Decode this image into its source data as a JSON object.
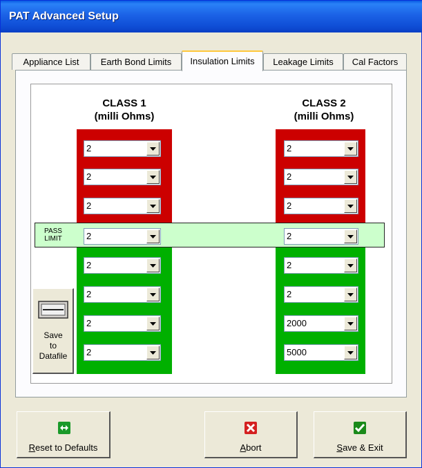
{
  "window": {
    "title": "PAT Advanced Setup"
  },
  "tabs": [
    {
      "label": "Appliance List"
    },
    {
      "label": "Earth Bond Limits"
    },
    {
      "label": "Insulation Limits"
    },
    {
      "label": "Leakage Limits"
    },
    {
      "label": "Cal Factors"
    }
  ],
  "active_tab": "Insulation Limits",
  "class1": {
    "title": "CLASS 1",
    "subtitle": "(milli Ohms)",
    "values": [
      "2",
      "2",
      "2",
      "2",
      "2",
      "2",
      "2",
      "2"
    ]
  },
  "class2": {
    "title": "CLASS 2",
    "subtitle": "(milli Ohms)",
    "values": [
      "2",
      "2",
      "2",
      "2",
      "2",
      "2",
      "2000",
      "5000"
    ]
  },
  "pass_limit": {
    "line1": "PASS",
    "line2": "LIMIT"
  },
  "save_datafile": {
    "line1": "Save",
    "line2": "to",
    "line3": "Datafile"
  },
  "buttons": {
    "reset": {
      "accel": "R",
      "rest": "eset to Defaults"
    },
    "abort": {
      "accel": "A",
      "rest": "bort"
    },
    "save_exit": {
      "accel": "S",
      "rest": "ave & Exit"
    }
  },
  "colors": {
    "title_bar": "#0a5be3",
    "fail_red": "#cc0000",
    "pass_green": "#00b000",
    "pass_band": "#ccffcc"
  },
  "icons": {
    "reset": "arrows-left-right-icon",
    "abort": "red-x-icon",
    "save_exit": "green-check-icon",
    "datafile": "disk-drive-icon"
  }
}
